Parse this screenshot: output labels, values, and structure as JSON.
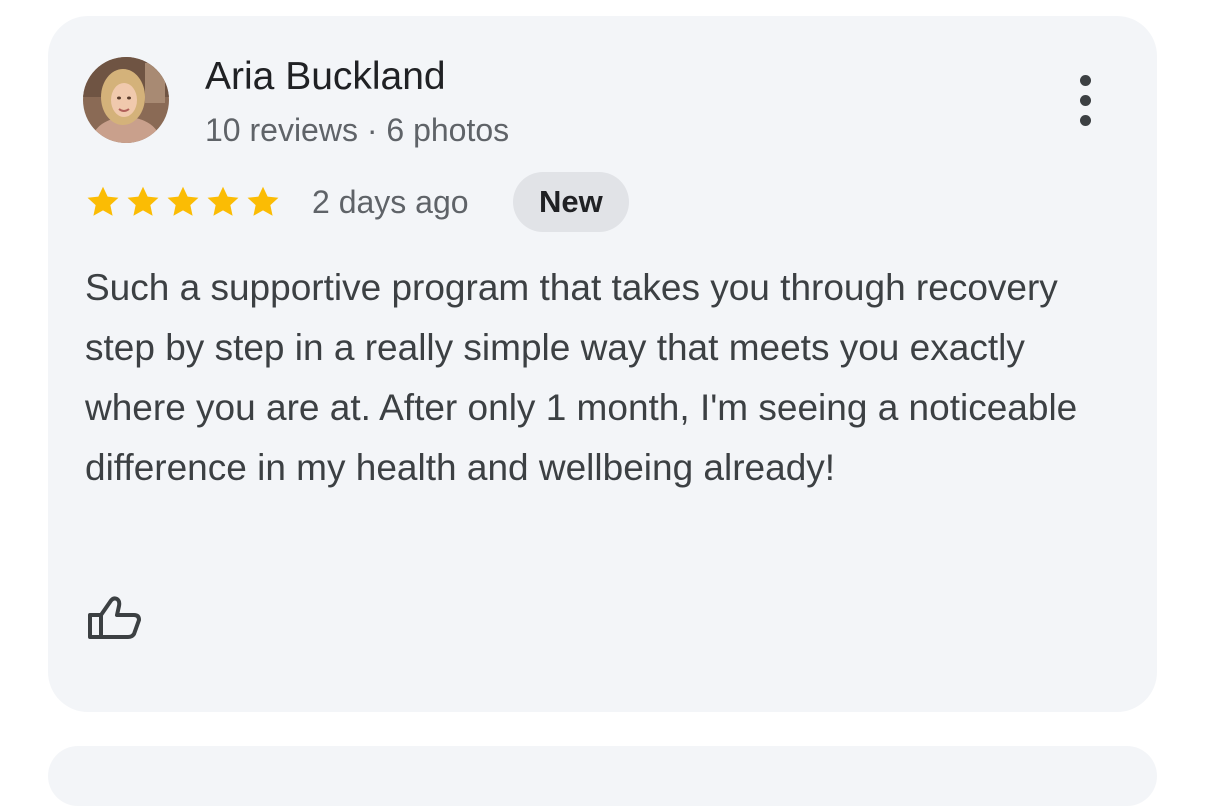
{
  "review": {
    "author_name": "Aria Buckland",
    "author_meta": "10 reviews · 6 photos",
    "rating": 5,
    "rating_max": 5,
    "time": "2 days ago",
    "badge": "New",
    "text": "Such a supportive program that takes you through recovery step by step in a really simple way that meets you exactly where you are at. After only 1 month, I'm seeing a noticeable difference in my health and wellbeing already!"
  },
  "icons": {
    "more": "more-vert-icon",
    "star": "star-icon",
    "like": "thumbs-up-icon"
  },
  "colors": {
    "card_background": "#f3f5f8",
    "star": "#fbbc04",
    "badge_background": "#e1e3e7",
    "primary_text": "#202124",
    "secondary_text": "#5f6368",
    "body_text": "#3c4043"
  }
}
